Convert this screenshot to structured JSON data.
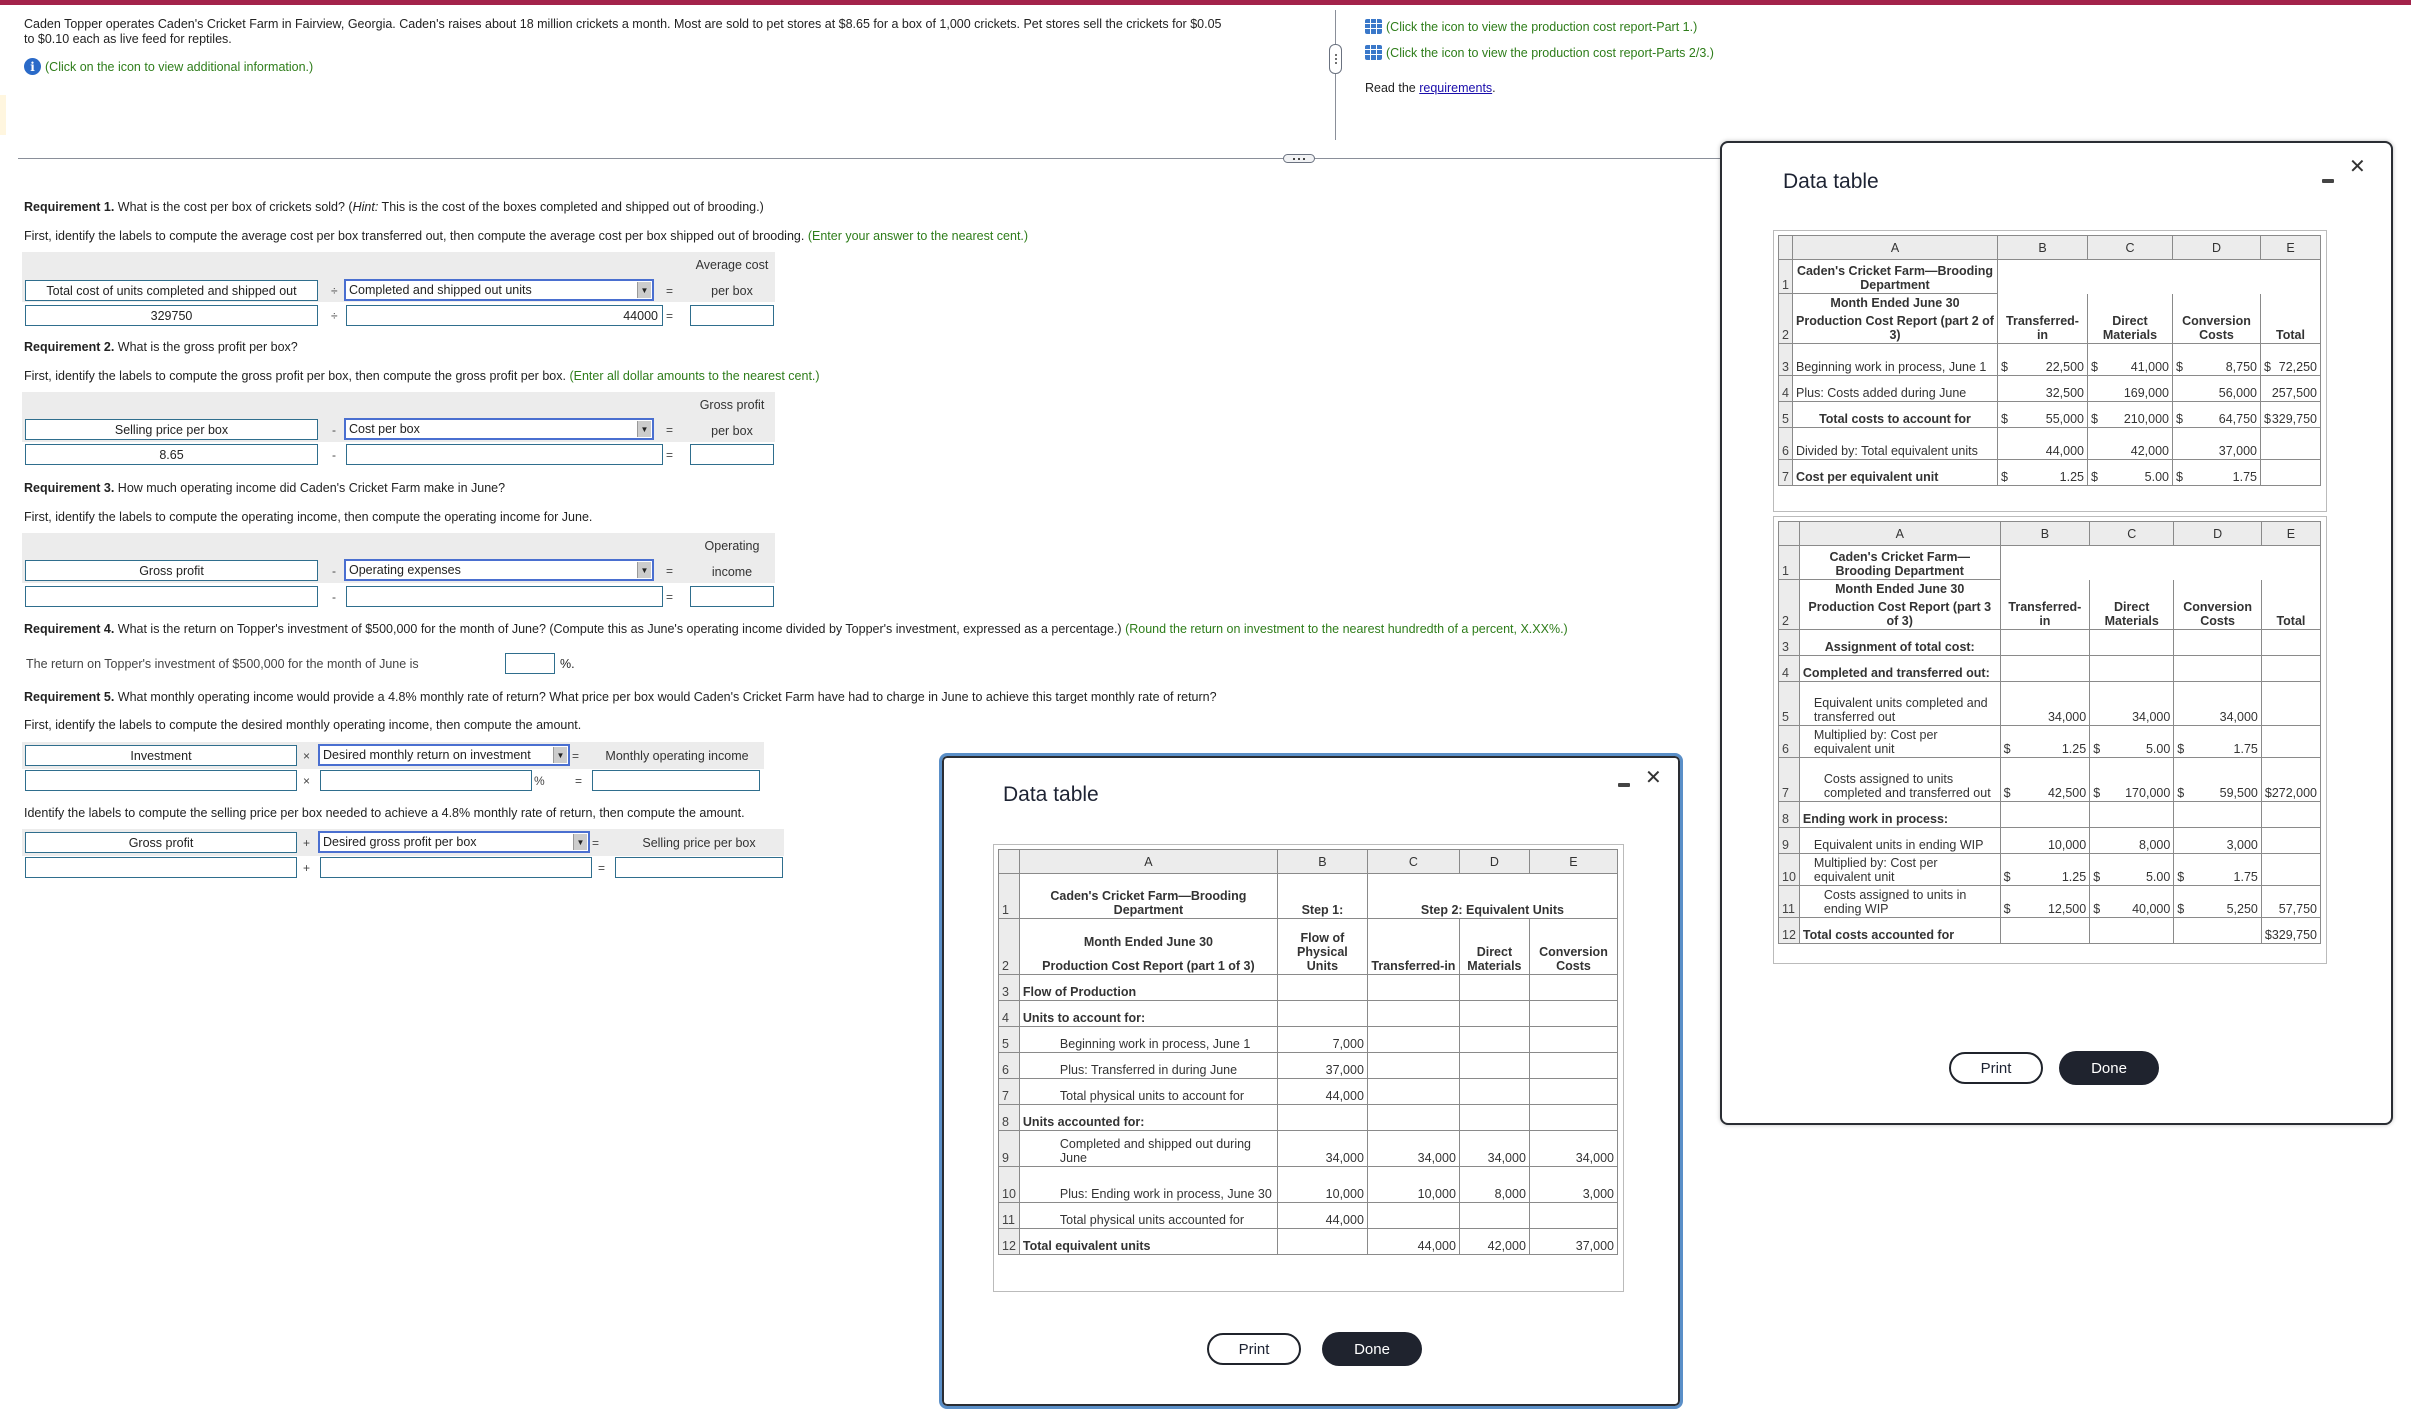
{
  "intro": {
    "text_line1": "Caden Topper operates Caden's Cricket Farm in Fairview, Georgia. Caden's raises about 18 million crickets a month. Most are sold to pet stores at $8.65 for a box of 1,000 crickets. Pet stores sell the crickets for $0.05",
    "text_line2": "to $0.10 each as live feed for reptiles.",
    "info_link": "(Click on the icon to view additional information.)"
  },
  "resources": {
    "link1": "(Click the icon to view the production cost report-Part 1.)",
    "link2": "(Click the icon to view the production cost report-Parts 2/3.)",
    "read_prefix": "Read the ",
    "read_link": "requirements",
    "read_suffix": "."
  },
  "req1": {
    "title": "Requirement 1.",
    "question_a": " What is the cost per box of crickets sold? (",
    "hint_label": "Hint:",
    "question_b": " This is the cost of the boxes completed and shipped out of brooding.)",
    "instruction": "First, identify the labels to compute the average cost per box transferred out, then compute the average cost per box shipped out of brooding.",
    "note": "(Enter your answer to the nearest cent.)",
    "label1": "Total cost of units completed and shipped out",
    "op": "÷",
    "label2": "Completed and shipped out units",
    "eq": "=",
    "result_hdr1": "Average cost",
    "result_hdr2": "per box",
    "value1": "329750",
    "value2": "44000",
    "result": ""
  },
  "req2": {
    "title": "Requirement 2.",
    "question": " What is the gross profit per box?",
    "instruction": "First, identify the labels to compute the gross profit per box, then compute the gross profit per box.",
    "note": "(Enter all dollar amounts to the nearest cent.)",
    "label1": "Selling price per box",
    "op": "-",
    "label2": "Cost per box",
    "eq": "=",
    "result_hdr1": "Gross profit",
    "result_hdr2": "per box",
    "value1": "8.65",
    "value2": "",
    "result": ""
  },
  "req3": {
    "title": "Requirement 3.",
    "question": " How much operating income did Caden's Cricket Farm make in June?",
    "instruction": "First, identify the labels to compute the operating income, then compute the operating income for June.",
    "label1": "Gross profit",
    "op": "-",
    "label2": "Operating expenses",
    "eq": "=",
    "result_hdr1": "Operating",
    "result_hdr2": "income",
    "value1": "",
    "value2": "",
    "result": ""
  },
  "req4": {
    "title": "Requirement 4.",
    "question": " What is the return on Topper's investment of $500,000 for the month of June? (Compute this as June's operating income divided by Topper's investment, expressed as a percentage.)",
    "note": "(Round the return on investment to the nearest hundredth of a percent, X.XX%.)",
    "sentence": "The return on Topper's investment of $500,000 for the month of June is",
    "value": "",
    "unit": "%."
  },
  "req5": {
    "title": "Requirement 5.",
    "question": " What monthly operating income would provide a 4.8% monthly rate of return? What price per box would Caden's Cricket Farm have had to charge in June to achieve this target monthly rate of return?",
    "instruction1": "First, identify the labels to compute the desired monthly operating income, then compute the amount.",
    "a_label1": "Investment",
    "a_op": "×",
    "a_label2": "Desired monthly return on investment",
    "a_eq": "=",
    "a_result_hdr": "Monthly operating income",
    "a_value1": "",
    "a_value2": "",
    "a_unit": "%",
    "a_result": "",
    "instruction2": "Identify the labels to compute the selling price per box needed to achieve a 4.8% monthly rate of return, then compute the amount.",
    "b_label1": "Gross profit",
    "b_op": "+",
    "b_label2": "Desired gross profit per box",
    "b_eq": "=",
    "b_result_hdr": "Selling price per box",
    "b_value1": "",
    "b_value2": "",
    "b_result": ""
  },
  "modal_part1": {
    "title": "Data table",
    "col_letters": [
      "A",
      "B",
      "C",
      "D",
      "E"
    ],
    "hdr_r1_a": "Caden's Cricket Farm—Brooding Department",
    "hdr_r1_b": "Step 1:",
    "hdr_r1_cde": "Step 2: Equivalent Units",
    "hdr_r2_a1": "Month Ended June 30",
    "hdr_r2_a2": "Production Cost Report (part 1 of 3)",
    "hdr_r2_b": "Flow of Physical Units",
    "hdr_r2_c": "Transferred-in",
    "hdr_r2_d": "Direct Materials",
    "hdr_r2_e": "Conversion Costs",
    "rows": [
      {
        "n": "3",
        "a": "Flow of Production",
        "b": "",
        "c": "",
        "d": "",
        "e": ""
      },
      {
        "n": "4",
        "a": "Units to account for:",
        "b": "",
        "c": "",
        "d": "",
        "e": ""
      },
      {
        "n": "5",
        "a": "Beginning work in process, June 1",
        "b": "7,000",
        "c": "",
        "d": "",
        "e": ""
      },
      {
        "n": "6",
        "a": "Plus: Transferred in during June",
        "b": "37,000",
        "c": "",
        "d": "",
        "e": ""
      },
      {
        "n": "7",
        "a": "Total physical units to account for",
        "b": "44,000",
        "c": "",
        "d": "",
        "e": ""
      },
      {
        "n": "8",
        "a": "Units accounted for:",
        "b": "",
        "c": "",
        "d": "",
        "e": ""
      },
      {
        "n": "9",
        "a": "Completed and shipped out during June",
        "b": "34,000",
        "c": "34,000",
        "d": "34,000",
        "e": "34,000"
      },
      {
        "n": "10",
        "a": "Plus: Ending work in process, June 30",
        "b": "10,000",
        "c": "10,000",
        "d": "8,000",
        "e": "3,000"
      },
      {
        "n": "11",
        "a": "Total physical units accounted for",
        "b": "44,000",
        "c": "",
        "d": "",
        "e": ""
      },
      {
        "n": "12",
        "a": "Total equivalent units",
        "b": "",
        "c": "44,000",
        "d": "42,000",
        "e": "37,000"
      }
    ],
    "print": "Print",
    "done": "Done"
  },
  "modal_part23": {
    "title": "Data table",
    "col_letters": [
      "A",
      "B",
      "C",
      "D",
      "E"
    ],
    "part2": {
      "hdr_a1": "Caden's Cricket Farm—Brooding Department",
      "hdr_a2": "Month Ended June 30",
      "hdr_a3": "Production Cost Report (part 2 of 3)",
      "hdr_b": "Transferred-in",
      "hdr_c": "Direct Materials",
      "hdr_d": "Conversion Costs",
      "hdr_e": "Total",
      "rows": [
        {
          "n": "3",
          "a": "Beginning work in process, June 1",
          "b": "22,500",
          "c": "41,000",
          "d": "8,750",
          "e": "72,250",
          "dollar": true,
          "edollar": true
        },
        {
          "n": "4",
          "a": "Plus: Costs added during June",
          "b": "32,500",
          "c": "169,000",
          "d": "56,000",
          "e": "257,500",
          "dollar": false,
          "edollar": false
        },
        {
          "n": "5",
          "a": "Total costs to account for",
          "b": "55,000",
          "c": "210,000",
          "d": "64,750",
          "e": "329,750",
          "dollar": true,
          "edollar": true
        },
        {
          "n": "6",
          "a": "Divided by: Total equivalent units",
          "b": "44,000",
          "c": "42,000",
          "d": "37,000",
          "e": "",
          "dollar": false,
          "edollar": false
        },
        {
          "n": "7",
          "a": "Cost per equivalent unit",
          "b": "1.25",
          "c": "5.00",
          "d": "1.75",
          "e": "",
          "dollar": true,
          "edollar": false
        }
      ]
    },
    "part3": {
      "hdr_a1": "Caden's Cricket Farm—Brooding Department",
      "hdr_a2": "Month Ended June 30",
      "hdr_a3": "Production Cost Report (part 3 of 3)",
      "hdr_b": "Transferred-in",
      "hdr_c": "Direct Materials",
      "hdr_d": "Conversion Costs",
      "hdr_e": "Total",
      "rows": [
        {
          "n": "3",
          "a": "Assignment of total cost:",
          "b": "",
          "c": "",
          "d": "",
          "e": "",
          "dollar": false,
          "edollar": false
        },
        {
          "n": "4",
          "a": "Completed and transferred out:",
          "b": "",
          "c": "",
          "d": "",
          "e": "",
          "dollar": false,
          "edollar": false
        },
        {
          "n": "5",
          "a": "Equivalent units completed and transferred out",
          "b": "34,000",
          "c": "34,000",
          "d": "34,000",
          "e": "",
          "dollar": false,
          "edollar": false
        },
        {
          "n": "6",
          "a": "Multiplied by: Cost per equivalent unit",
          "b": "1.25",
          "c": "5.00",
          "d": "1.75",
          "e": "",
          "dollar": true,
          "edollar": false
        },
        {
          "n": "7",
          "a": "Costs assigned to units completed and transferred out",
          "b": "42,500",
          "c": "170,000",
          "d": "59,500",
          "e": "272,000",
          "dollar": true,
          "edollar": true
        },
        {
          "n": "8",
          "a": "Ending work in process:",
          "b": "",
          "c": "",
          "d": "",
          "e": "",
          "dollar": false,
          "edollar": false
        },
        {
          "n": "9",
          "a": "Equivalent units in ending WIP",
          "b": "10,000",
          "c": "8,000",
          "d": "3,000",
          "e": "",
          "dollar": false,
          "edollar": false
        },
        {
          "n": "10",
          "a": "Multiplied by: Cost per equivalent unit",
          "b": "1.25",
          "c": "5.00",
          "d": "1.75",
          "e": "",
          "dollar": true,
          "edollar": false
        },
        {
          "n": "11",
          "a": "Costs assigned to units in ending WIP",
          "b": "12,500",
          "c": "40,000",
          "d": "5,250",
          "e": "57,750",
          "dollar": true,
          "edollar": false
        },
        {
          "n": "12",
          "a": "Total costs accounted for",
          "b": "",
          "c": "",
          "d": "",
          "e": "329,750",
          "dollar": false,
          "edollar": true
        }
      ]
    },
    "print": "Print",
    "done": "Done"
  }
}
